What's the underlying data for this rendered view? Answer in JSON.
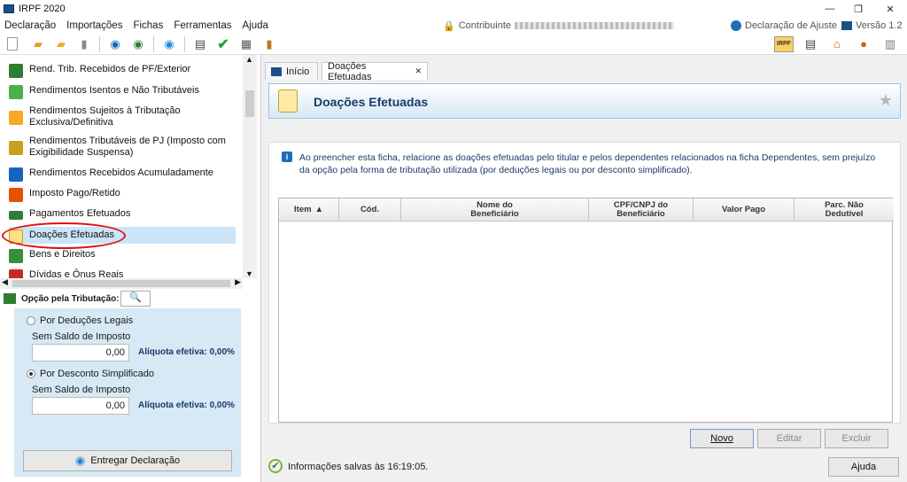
{
  "window": {
    "title": "IRPF 2020",
    "minimize": "—",
    "maximize": "❐",
    "close": "✕"
  },
  "menu": [
    "Declaração",
    "Importações",
    "Fichas",
    "Ferramentas",
    "Ajuda"
  ],
  "header_info": {
    "contribuinte_label": "Contribuinte",
    "declaration_type": "Declaração de Ajuste",
    "version": "Versão 1.2"
  },
  "nav": {
    "items": [
      {
        "label": "Rend. Trib. Recebidos de PF/Exterior",
        "color": "#2e7d32"
      },
      {
        "label": "Rendimentos Isentos e Não Tributáveis",
        "color": "#4caf50"
      },
      {
        "label": "Rendimentos Sujeitos à Tributação Exclusiva/Definitiva",
        "color": "#f9a825"
      },
      {
        "label": "Rendimentos Tributáveis de PJ (Imposto com Exigibilidade Suspensa)",
        "color": "#c8a020"
      },
      {
        "label": "Rendimentos Recebidos Acumuladamente",
        "color": "#1565c0"
      },
      {
        "label": "Imposto Pago/Retido",
        "color": "#e65100"
      },
      {
        "label": "Pagamentos Efetuados",
        "color": "#2e7d32"
      },
      {
        "label": "Doações Efetuadas",
        "color": "#ffe082"
      },
      {
        "label": "Bens e Direitos",
        "color": "#388e3c"
      },
      {
        "label": "Dívidas e Ônus Reais",
        "color": "#c62828"
      }
    ]
  },
  "option": {
    "title": "Opção pela Tributação:",
    "legal": {
      "label": "Por Deduções Legais",
      "sub": "Sem Saldo de Imposto",
      "value": "0,00",
      "rate": "Alíquota efetiva: 0,00%",
      "selected": false
    },
    "simplified": {
      "label": "Por Desconto Simplificado",
      "sub": "Sem Saldo de Imposto",
      "value": "0,00",
      "rate": "Alíquota efetiva: 0,00%",
      "selected": true
    },
    "submit": "Entregar Declaração"
  },
  "tabs": [
    {
      "label": "Início"
    },
    {
      "label": "Doações Efetuadas"
    }
  ],
  "page": {
    "title": "Doações Efetuadas",
    "info": "Ao preencher esta ficha, relacione as doações efetuadas pelo titular e pelos dependentes relacionados na ficha Dependentes, sem prejuízo da opção pela forma de tributação utilizada (por deduções legais ou por desconto simplificado)."
  },
  "table": {
    "columns": [
      "Item",
      "Cód.",
      "Nome do Beneficiário",
      "CPF/CNPJ do Beneficiário",
      "Valor Pago",
      "Parc. Não Dedutível"
    ]
  },
  "buttons": {
    "new": "Novo",
    "edit": "Editar",
    "delete": "Excluir",
    "help": "Ajuda"
  },
  "status": {
    "text": "Informações salvas às 16:19:05."
  },
  "colors": {
    "accent": "#1c4f8a",
    "highlight": "#e01010"
  }
}
